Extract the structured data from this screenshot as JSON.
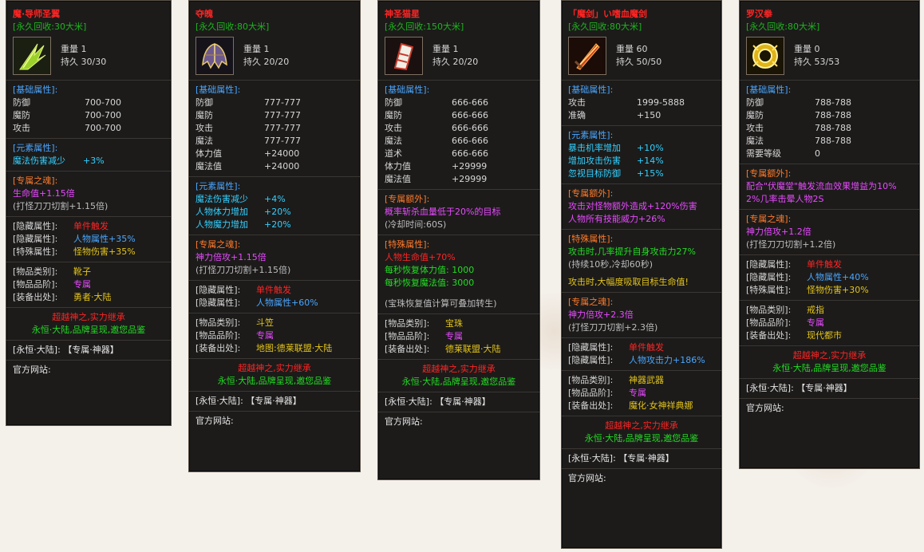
{
  "items": [
    {
      "name": "魔·导师圣翼",
      "name_color": "#ff3a1e",
      "recycle": "[永久回收:30大米]",
      "icon": "green-wing-icon",
      "stats": [
        "重量 1",
        "持久 30/30"
      ],
      "base_title": "[基础属性]:",
      "base": [
        [
          "防御",
          "700-700"
        ],
        [
          "魔防",
          "700-700"
        ],
        [
          "攻击",
          "700-700"
        ]
      ],
      "elem_title": "[元素属性]:",
      "elem": [
        [
          "魔法伤害减少",
          "+3%"
        ]
      ],
      "soul_title": "[专属之魂]:",
      "soul": [
        "生命值+1.15倍",
        "(打怪刀刀切割+1.15倍)"
      ],
      "hidden": [
        [
          "[隐藏属性]:",
          "单件触发"
        ],
        [
          "[隐藏属性]:",
          "人物属性+35%"
        ],
        [
          "[特殊属性]:",
          "怪物伤害+35%"
        ]
      ],
      "info": [
        [
          "[物品类别]:",
          "靴子"
        ],
        [
          "[物品品阶]:",
          "专属"
        ],
        [
          "[装备出处]:",
          "勇者·大陆"
        ]
      ],
      "slogan1": "超越神之,实力继承",
      "slogan2": "永恒·大陆,品牌呈现,邀您品鉴",
      "footer": "[永恒·大陆]: 【专属·神器】",
      "site": "官方网站:"
    },
    {
      "name": "夺魄",
      "name_color": "#ff3a1e",
      "recycle": "[永久回收:80大米]",
      "icon": "helmet-icon",
      "stats": [
        "重量 1",
        "持久 20/20"
      ],
      "base_title": "[基础属性]:",
      "base": [
        [
          "防御",
          "777-777"
        ],
        [
          "魔防",
          "777-777"
        ],
        [
          "攻击",
          "777-777"
        ],
        [
          "魔法",
          "777-777"
        ],
        [
          "体力值",
          "+24000"
        ],
        [
          "魔法值",
          "+24000"
        ]
      ],
      "elem_title": "[元素属性]:",
      "elem": [
        [
          "魔法伤害减少",
          "+4%"
        ],
        [
          "人物体力增加",
          "+20%"
        ],
        [
          "人物魔力增加",
          "+20%"
        ]
      ],
      "soul_title": "[专属之魂]:",
      "soul": [
        "神力倍攻+1.15倍",
        "(打怪刀刀切割+1.15倍)"
      ],
      "hidden": [
        [
          "[隐藏属性]:",
          "单件触发"
        ],
        [
          "[隐藏属性]:",
          "人物属性+60%"
        ]
      ],
      "info": [
        [
          "[物品类别]:",
          "斗笠"
        ],
        [
          "[物品品阶]:",
          "专属"
        ],
        [
          "[装备出处]:",
          "地图:德莱联盟·大陆"
        ]
      ],
      "slogan1": "超越神之,实力继承",
      "slogan2": "永恒·大陆,品牌呈现,邀您品鉴",
      "footer": "[永恒·大陆]: 【专属·神器】",
      "site": "官方网站:"
    },
    {
      "name": "神圣猫星",
      "name_color": "#ff3a1e",
      "recycle": "[永久回收:150大米]",
      "icon": "scroll-gem-icon",
      "stats": [
        "重量 1",
        "持久 20/20"
      ],
      "base_title": "[基础属性]:",
      "base": [
        [
          "防御",
          "666-666"
        ],
        [
          "魔防",
          "666-666"
        ],
        [
          "攻击",
          "666-666"
        ],
        [
          "魔法",
          "666-666"
        ],
        [
          "道术",
          "666-666"
        ],
        [
          "体力值",
          "+29999"
        ],
        [
          "魔法值",
          "+29999"
        ]
      ],
      "extra_title": "[专属额外]:",
      "extra": [
        "概率斩杀血量低于20%的目标",
        "(冷却时间:60S)"
      ],
      "special_title": "[特殊属性]:",
      "special": [
        "人物生命值+70%",
        "每秒恢复体力值: 1000",
        "每秒恢复魔法值: 3000"
      ],
      "note": "(宝珠恢复值计算可叠加转生)",
      "info": [
        [
          "[物品类别]:",
          "宝珠"
        ],
        [
          "[物品品阶]:",
          "专属"
        ],
        [
          "[装备出处]:",
          "德莱联盟·大陆"
        ]
      ],
      "slogan1": "超越神之,实力继承",
      "slogan2": "永恒·大陆,品牌呈现,邀您品鉴",
      "footer": "[永恒·大陆]: 【专属·神器】",
      "site": "官方网站:"
    },
    {
      "name": "「魔剑」い嗜血魔剑",
      "name_color": "#ff3a1e",
      "recycle": "[永久回收:80大米]",
      "icon": "flame-sword-icon",
      "stats": [
        "重量 60",
        "持久 50/50"
      ],
      "base_title": "[基础属性]:",
      "base": [
        [
          "攻击",
          "1999-5888"
        ],
        [
          "准确",
          "+150"
        ]
      ],
      "elem_title": "[元素属性]:",
      "elem": [
        [
          "暴击机率增加",
          "+10%"
        ],
        [
          "增加攻击伤害",
          "+14%"
        ],
        [
          "忽视目标防御",
          "+15%"
        ]
      ],
      "extra_title": "[专属额外]:",
      "extra": [
        "攻击对怪物额外造成+120%伤害",
        "人物所有技能威力+26%"
      ],
      "special_title": "[特殊属性]:",
      "special": [
        "攻击时,几率提升自身攻击力27%",
        "(持续10秒,冷却60秒)"
      ],
      "special_gold": "攻击时,大幅度吸取目标生命值!",
      "soul_title": "[专属之魂]:",
      "soul": [
        "神力倍攻+2.3倍",
        "(打怪刀刀切割+2.3倍)"
      ],
      "hidden": [
        [
          "[隐藏属性]:",
          "单件触发"
        ],
        [
          "[隐藏属性]:",
          "人物攻击力+186%"
        ]
      ],
      "info": [
        [
          "[物品类别]:",
          "神器武器"
        ],
        [
          "[物品品阶]:",
          "专属"
        ],
        [
          "[装备出处]:",
          "魔化·女神祥典娜"
        ]
      ],
      "slogan1": "超越神之,实力继承",
      "slogan2": "永恒·大陆,品牌呈现,邀您品鉴",
      "footer": "[永恒·大陆]: 【专属·神器】",
      "site": "官方网站:"
    },
    {
      "name": "罗汉拳",
      "name_color": "#ff3a1e",
      "recycle": "[永久回收:80大米]",
      "icon": "golden-fist-icon",
      "stats": [
        "重量 0",
        "持久 53/53"
      ],
      "base_title": "[基础属性]:",
      "base": [
        [
          "防御",
          "788-788"
        ],
        [
          "魔防",
          "788-788"
        ],
        [
          "攻击",
          "788-788"
        ],
        [
          "魔法",
          "788-788"
        ],
        [
          "需要等级",
          "0"
        ]
      ],
      "extra_title": "[专属额外]:",
      "extra": [
        "配合\"伏魔堂\"触发流血效果增益为10%",
        "2%几率击晕人物2S"
      ],
      "soul_title": "[专属之魂]:",
      "soul": [
        "神力倍攻+1.2倍",
        "(打怪刀刀切割+1.2倍)"
      ],
      "hidden": [
        [
          "[隐藏属性]:",
          "单件触发"
        ],
        [
          "[隐藏属性]:",
          "人物属性+40%"
        ],
        [
          "[特殊属性]:",
          "怪物伤害+30%"
        ]
      ],
      "info": [
        [
          "[物品类别]:",
          "戒指"
        ],
        [
          "[物品品阶]:",
          "专属"
        ],
        [
          "[装备出处]:",
          "现代都市"
        ]
      ],
      "slogan1": "超越神之,实力继承",
      "slogan2": "永恒·大陆,品牌呈现,邀您品鉴",
      "footer": "[永恒·大陆]: 【专属·神器】",
      "site": "官方网站:"
    }
  ]
}
